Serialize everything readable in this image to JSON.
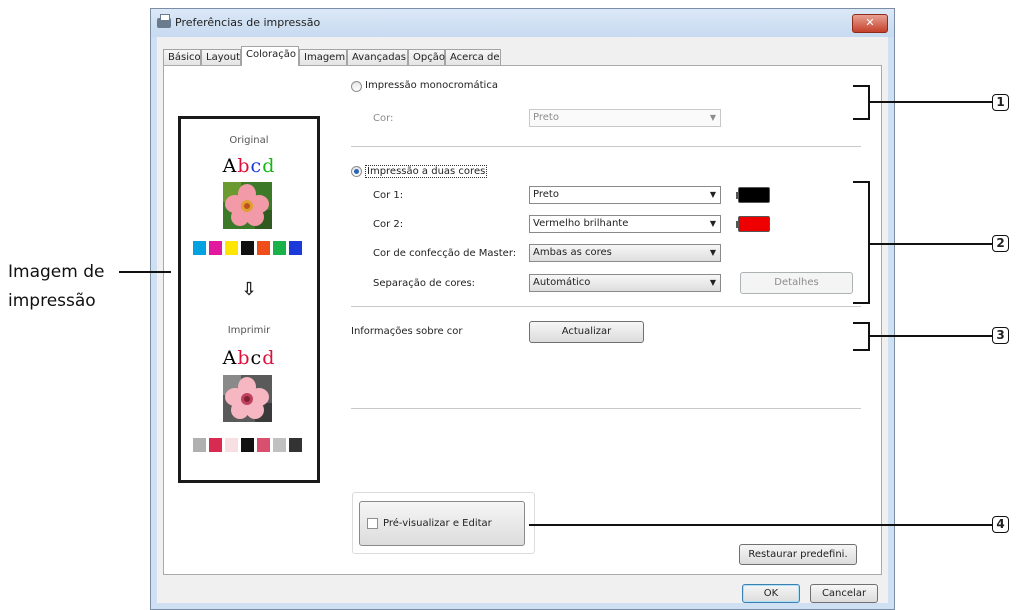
{
  "window": {
    "title": "Preferências de impressão",
    "close_glyph": "✕"
  },
  "tabs": [
    {
      "label": "Básico"
    },
    {
      "label": "Layout"
    },
    {
      "label": "Coloração"
    },
    {
      "label": "Imagem"
    },
    {
      "label": "Avançadas"
    },
    {
      "label": "Opção"
    },
    {
      "label": "Acerca de"
    }
  ],
  "preview": {
    "original_label": "Original",
    "print_label": "Imprimir",
    "sample_text_original": [
      "A",
      "b",
      "c",
      "d"
    ],
    "sample_text_print": [
      "A",
      "b",
      "c",
      "d"
    ],
    "original_text_colors": [
      "#000000",
      "#e0103a",
      "#1a3adc",
      "#16b816"
    ],
    "print_text_colors": [
      "#000000",
      "#e0103a",
      "#000000",
      "#e0103a"
    ],
    "original_swatches": [
      "#00a3e0",
      "#e0199e",
      "#ffe600",
      "#111111",
      "#ef4e1a",
      "#19b24a",
      "#1b3ad9"
    ],
    "print_swatches": [
      "#b0b0b0",
      "#d92a52",
      "#f7dfe4",
      "#111111",
      "#d9506e",
      "#c0c0c0",
      "#333333"
    ]
  },
  "mono": {
    "radio_label": "Impressão monocromática",
    "color_label": "Cor:",
    "color_value": "Preto",
    "selected": false
  },
  "dual": {
    "radio_label": "Impressão a duas cores",
    "selected": true,
    "color1_label": "Cor 1:",
    "color1_value": "Preto",
    "color1_swatch": "#000000",
    "color2_label": "Cor 2:",
    "color2_value": "Vermelho brilhante",
    "color2_swatch": "#ee0000",
    "master_label": "Cor de confecção de Master:",
    "master_value": "Ambas as cores",
    "separation_label": "Separação de cores:",
    "separation_value": "Automático",
    "details_button": "Detalhes"
  },
  "color_info": {
    "label": "Informações sobre cor",
    "update_button": "Actualizar"
  },
  "preview_edit": {
    "checkbox_label": "Pré-visualizar e Editar",
    "checked": false
  },
  "buttons": {
    "restore": "Restaurar predefini.",
    "ok": "OK",
    "cancel": "Cancelar"
  },
  "annotations": {
    "image_label_line1": "Imagem de",
    "image_label_line2": "impressão",
    "callouts": [
      "1",
      "2",
      "3",
      "4"
    ]
  },
  "arrow_glyph": "⇩"
}
